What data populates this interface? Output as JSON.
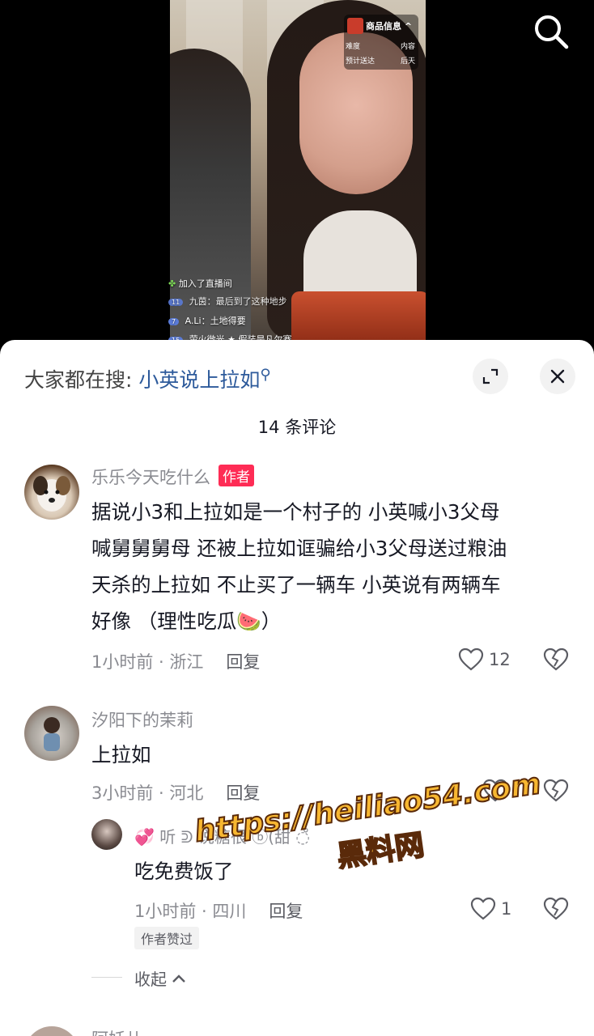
{
  "live": {
    "product_tag": {
      "title": "商品信息 ^",
      "row1_left": "难度",
      "row1_right": "内容",
      "row2_left": "预计送达",
      "row2_right": "后天"
    },
    "messages": [
      {
        "level": "",
        "text": "加入了直播间"
      },
      {
        "level": "11",
        "text": "九茵：最后到了这种地步"
      },
      {
        "level": "7",
        "text": "A.Li：土地得要"
      },
      {
        "level": "15",
        "text": "萤火微光 ★ 假装是凡尔赛"
      }
    ]
  },
  "sheet": {
    "hot_search_label": "大家都在搜:",
    "hot_search_term": "小英说上拉如",
    "hot_search_icon": "search-icon",
    "comment_count_title": "14 条评论"
  },
  "comments": [
    {
      "username": "乐乐今天吃什么",
      "badge": "作者",
      "lines": [
        "据说小3和上拉如是一个村子的 小英喊小3父母",
        "喊舅舅舅母 还被上拉如诓骗给小3父母送过粮油",
        "天杀的上拉如 不止买了一辆车 小英说有两辆车",
        "好像 （理性吃瓜🍉）"
      ],
      "time_location": "1小时前 · 浙江",
      "reply_label": "回复",
      "likes": "12"
    },
    {
      "username": "汐阳下的茉莉",
      "text": "上拉如",
      "time_location": "3小时前 · 河北",
      "reply_label": "回复",
      "likes": ""
    }
  ],
  "reply": {
    "username": "💞 听 ᕲ 说糖很 ⓑ(甜 ◌̊",
    "text": "吃免费饭了",
    "time_location": "1小时前 · 四川",
    "reply_label": "回复",
    "likes": "1",
    "author_liked": "作者赞过"
  },
  "collapse_label": "收起",
  "next_comment_partial": "阿妖儿",
  "watermark": {
    "url": "https://heiliao54.com",
    "cn": "黑料网"
  },
  "colors": {
    "accent_red": "#fe2c55",
    "link_blue": "#2d5a9b",
    "watermark": "#f7b731"
  }
}
